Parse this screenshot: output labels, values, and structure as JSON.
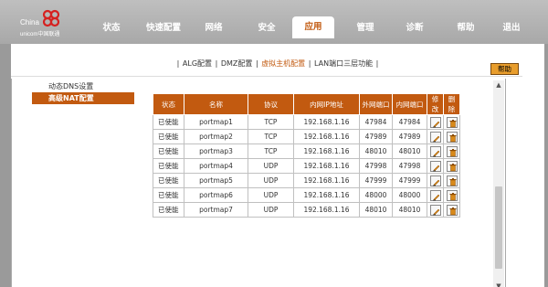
{
  "brand": {
    "name_cn": "China",
    "name_en": "unicom中国联通"
  },
  "nav": [
    {
      "label": "状态"
    },
    {
      "label": "快速配置"
    },
    {
      "label": "网络"
    },
    {
      "label": "安全"
    },
    {
      "label": "应用",
      "active": true
    },
    {
      "label": "管理"
    },
    {
      "label": "诊断"
    },
    {
      "label": "帮助"
    },
    {
      "label": "退出"
    }
  ],
  "subnav": [
    {
      "label": "ALG配置"
    },
    {
      "label": "DMZ配置"
    },
    {
      "label": "虚拟主机配置",
      "active": true
    },
    {
      "label": "LAN端口三层功能"
    }
  ],
  "help_button": "帮助",
  "sidebar": [
    {
      "label": "动态DNS设置"
    },
    {
      "label": "高级NAT配置",
      "active": true
    }
  ],
  "table": {
    "headers": [
      "状态",
      "名称",
      "协议",
      "内网IP地址",
      "外网端口",
      "内网端口",
      "修改",
      "删除"
    ],
    "rows": [
      {
        "state": "已使能",
        "name": "portmap1",
        "proto": "TCP",
        "ip": "192.168.1.16",
        "ext": "47984",
        "int": "47984"
      },
      {
        "state": "已使能",
        "name": "portmap2",
        "proto": "TCP",
        "ip": "192.168.1.16",
        "ext": "47989",
        "int": "47989"
      },
      {
        "state": "已使能",
        "name": "portmap3",
        "proto": "TCP",
        "ip": "192.168.1.16",
        "ext": "48010",
        "int": "48010"
      },
      {
        "state": "已使能",
        "name": "portmap4",
        "proto": "UDP",
        "ip": "192.168.1.16",
        "ext": "47998",
        "int": "47998"
      },
      {
        "state": "已使能",
        "name": "portmap5",
        "proto": "UDP",
        "ip": "192.168.1.16",
        "ext": "47999",
        "int": "47999"
      },
      {
        "state": "已使能",
        "name": "portmap6",
        "proto": "UDP",
        "ip": "192.168.1.16",
        "ext": "48000",
        "int": "48000"
      },
      {
        "state": "已使能",
        "name": "portmap7",
        "proto": "UDP",
        "ip": "192.168.1.16",
        "ext": "48010",
        "int": "48010"
      }
    ]
  },
  "colors": {
    "accent": "#c25a10",
    "help_button": "#e89d2c",
    "topbar": "#b3b3b3"
  }
}
